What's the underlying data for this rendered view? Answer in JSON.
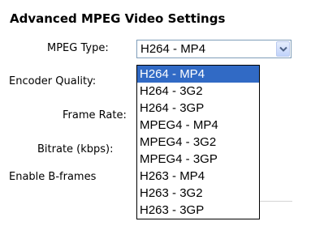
{
  "section_title": "Advanced MPEG Video Settings",
  "labels": {
    "mpeg_type": "MPEG Type:",
    "encoder_quality": "Encoder Quality:",
    "frame_rate": "Frame Rate:",
    "bitrate": "Bitrate (kbps):",
    "bframes": "Enable B-frames"
  },
  "mpeg_type_select": {
    "value": "H264 - MP4",
    "options": [
      "H264 - MP4",
      "H264 - 3G2",
      "H264 - 3GP",
      "MPEG4 - MP4",
      "MPEG4 - 3G2",
      "MPEG4 - 3GP",
      "H263 - MP4",
      "H263 - 3G2",
      "H263 - 3GP"
    ],
    "highlighted_option": "H264 - MP4"
  },
  "icons": {
    "dropdown_arrow": "chevron-down-icon"
  },
  "colors": {
    "highlight": "#316ac5",
    "select_border": "#7f9db9"
  }
}
